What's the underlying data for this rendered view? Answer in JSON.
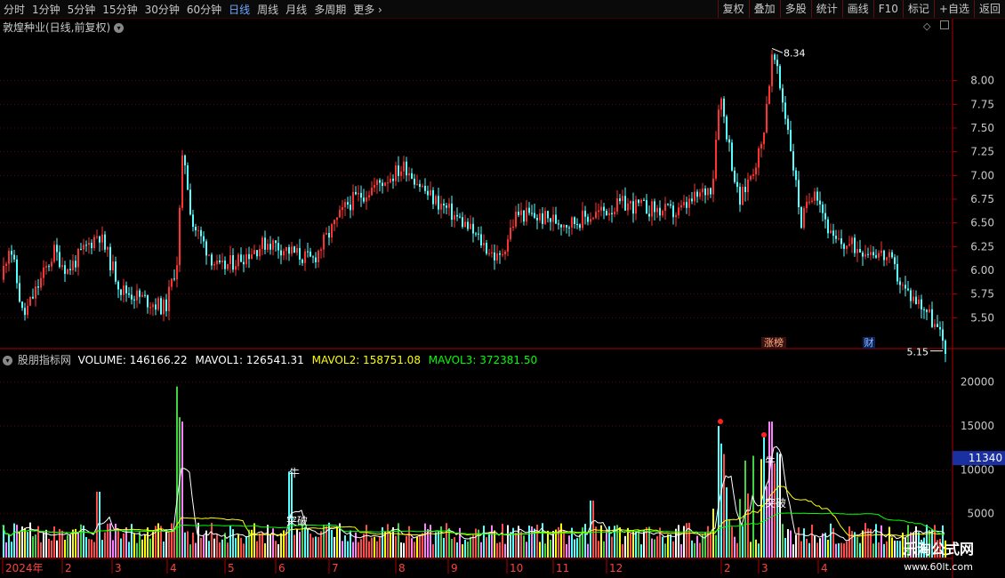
{
  "toolbar": {
    "periods": [
      "分时",
      "1分钟",
      "5分钟",
      "15分钟",
      "30分钟",
      "60分钟",
      "日线",
      "周线",
      "月线",
      "多周期",
      "更多"
    ],
    "active_period": "日线",
    "more_arrow": "›",
    "tools": [
      "复权",
      "叠加",
      "多股",
      "统计",
      "画线",
      "F10",
      "标记",
      "+自选",
      "返回"
    ]
  },
  "stock": {
    "title": "敦煌种业(日线,前复权)",
    "high_label": "8.34",
    "low_label": "5.15",
    "price_ticks": [
      "8.00",
      "7.75",
      "7.50",
      "7.25",
      "7.00",
      "6.75",
      "6.50",
      "6.25",
      "6.00",
      "5.75",
      "5.50"
    ],
    "markers": [
      "涨榜",
      "财"
    ]
  },
  "volume": {
    "indicator_name": "股朋指标网",
    "volume": "VOLUME: 146166.22",
    "mavol1": "MAVOL1: 126541.31",
    "mavol2": "MAVOL2: 158751.08",
    "mavol3": "MAVOL3: 372381.50",
    "ticks": [
      "20000",
      "15000",
      "10000",
      "5000"
    ],
    "current_value": "11340",
    "signals": [
      "牛",
      "突破",
      "牛",
      "突破"
    ]
  },
  "timeline": {
    "labels": [
      "2024年",
      "2",
      "3",
      "4",
      "5",
      "6",
      "7",
      "8",
      "9",
      "10",
      "11",
      "12",
      "2",
      "3",
      "4"
    ]
  },
  "watermark": {
    "line1": "乐淘公式网",
    "line2": "www.60lt.com"
  },
  "colors": {
    "up": "#ff3232",
    "down": "#54ffff",
    "grid": "#5a0a0a",
    "mavol1": "#ffffff",
    "mavol2": "#ffff00",
    "mavol3": "#00ff00",
    "active": "#6fa8ff"
  }
}
